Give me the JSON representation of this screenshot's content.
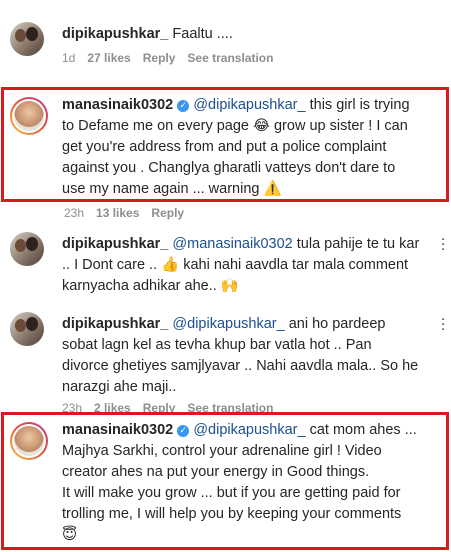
{
  "comments": [
    {
      "username": "dipikapushkar_",
      "body": "Faaltu ....",
      "meta": {
        "time": "1d",
        "likes": "27 likes",
        "reply": "Reply",
        "translate": "See translation"
      }
    },
    {
      "username": "manasinaik0302",
      "mention": "@dipikapushkar_",
      "body_line1_rest": " this girl is trying",
      "lines": [
        "to Defame me on every page 😂 grow up sister ! I can",
        "get you're address from and put a police complaint",
        "against you . Changlya gharatli vatteys don't dare to",
        "use my name again ... warning ⚠️"
      ],
      "meta": {
        "time": "23h",
        "likes": "13 likes",
        "reply": "Reply"
      }
    },
    {
      "username": "dipikapushkar_",
      "mention": "@manasinaik0302",
      "body_line1_rest": " tula pahije te tu kar",
      "lines": [
        ".. I Dont care .. 👍 kahi nahi aavdla tar mala comment",
        "karnyacha adhikar ahe.. 🙌"
      ]
    },
    {
      "username": "dipikapushkar_",
      "mention": "@dipikapushkar_",
      "body_line1_rest": " ani ho pardeep",
      "lines": [
        "sobat lagn kel as tevha khup bar vatla hot .. Pan",
        "divorce ghetiyes samjlyavar .. Nahi aavdla mala.. So he",
        "narazgi ahe maji.."
      ],
      "meta": {
        "time": "23h",
        "likes": "2 likes",
        "reply": "Reply",
        "translate": "See translation"
      }
    },
    {
      "username": "manasinaik0302",
      "mention": "@dipikapushkar_",
      "body_line1_rest": " cat mom ahes ...",
      "lines": [
        "Majhya Sarkhi, control your adrenaline girl ! Video",
        "creator ahes na put your energy in Good things.",
        "It will make you grow ... but if you are getting paid for",
        "trolling me, I will help you by keeping your comments",
        "😇"
      ]
    }
  ],
  "icons": {
    "verified": "verified-badge-icon",
    "more": "more-options-icon"
  },
  "colors": {
    "highlight": "#d9191e",
    "mention": "#1d4f91",
    "meta": "#8e8e8e",
    "verified": "#3897f0"
  }
}
